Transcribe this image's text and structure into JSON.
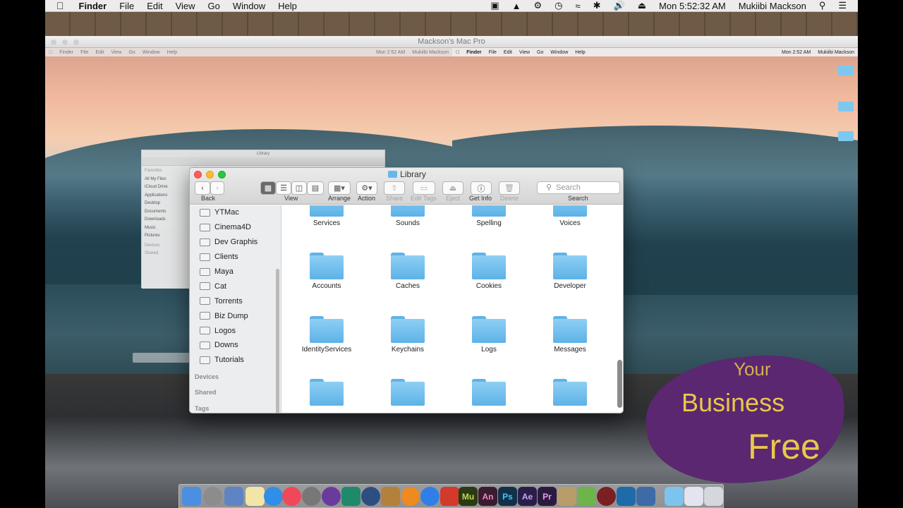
{
  "host_menubar": {
    "app": "Finder",
    "menus": [
      "File",
      "Edit",
      "View",
      "Go",
      "Window",
      "Help"
    ],
    "clock": "Mon 5:52:32 AM",
    "user": "Mukiibi Mackson"
  },
  "vm_window": {
    "title": "Mackson's Mac Pro"
  },
  "guest_left": {
    "menus": [
      "Finder",
      "File",
      "Edit",
      "View",
      "Go",
      "Window",
      "Help"
    ],
    "clock": "Mon 2:52 AM",
    "user": "Mukiibi Mackson",
    "mini_window_title": "Library",
    "favorites_header": "Favorites",
    "favorites": [
      "All My Files",
      "iCloud Drive",
      "Applications",
      "Desktop",
      "Documents",
      "Downloads",
      "Music",
      "Pictures"
    ],
    "devices_header": "Devices",
    "shared_header": "Shared"
  },
  "guest_right": {
    "menus": [
      "Finder",
      "File",
      "Edit",
      "View",
      "Go",
      "Window",
      "Help"
    ],
    "clock": "Mon 2:52 AM",
    "user": "Mukiibi Mackson"
  },
  "finder": {
    "title": "Library",
    "toolbar": {
      "back": "Back",
      "view": "View",
      "arrange": "Arrange",
      "action": "Action",
      "share": "Share",
      "edit_tags": "Edit Tags",
      "eject": "Eject",
      "get_info": "Get Info",
      "delete": "Delete",
      "search_label": "Search",
      "search_placeholder": "Search"
    },
    "sidebar_items": [
      "YTMac",
      "Cinema4D",
      "Dev Graphis",
      "Clients",
      "Maya",
      "Cat",
      "Torrents",
      "Biz Dump",
      "Logos",
      "Downs",
      "Tutorials"
    ],
    "sidebar_sections": [
      "Devices",
      "Shared",
      "Tags"
    ],
    "folders_row0": [
      "Services",
      "Sounds",
      "Spelling",
      "Voices"
    ],
    "folders_row1": [
      "Accounts",
      "Caches",
      "Cookies",
      "Developer"
    ],
    "folders_row2": [
      "IdentityServices",
      "Keychains",
      "Logs",
      "Messages"
    ]
  },
  "promo": {
    "line1": "Your",
    "line2": "Business",
    "line3": "Free",
    "colors": {
      "bg": "#5b2770",
      "text": "#e9c84a"
    }
  },
  "dock": {
    "labels": [
      "Mu",
      "An",
      "Ps",
      "Ae",
      "Pr"
    ]
  }
}
